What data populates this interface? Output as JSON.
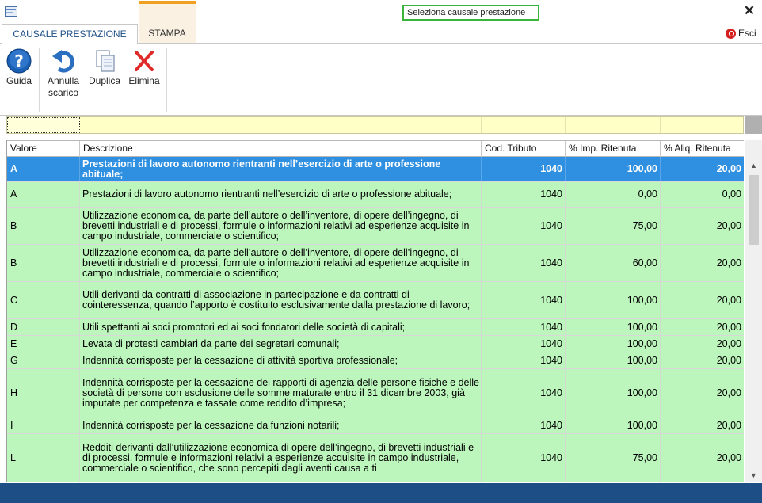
{
  "window": {
    "title": "Seleziona causale prestazione",
    "close_glyph": "✕"
  },
  "tabs": [
    {
      "label": "CAUSALE PRESTAZIONE",
      "active": true
    },
    {
      "label": "STAMPA",
      "active": false
    }
  ],
  "esci_label": "Esci",
  "ribbon": {
    "guida": {
      "label": "Guida",
      "icon": "help-icon"
    },
    "annulla": {
      "label_line1": "Annulla",
      "label_line2": "scarico",
      "icon": "undo-icon"
    },
    "duplica": {
      "label": "Duplica",
      "icon": "duplicate-icon"
    },
    "elimina": {
      "label": "Elimina",
      "icon": "delete-icon"
    }
  },
  "grid": {
    "columns": {
      "valore": "Valore",
      "descrizione": "Descrizione",
      "cod_tributo": "Cod. Tributo",
      "imp_ritenuta": "% Imp. Ritenuta",
      "aliq_ritenuta": "% Aliq. Ritenuta"
    },
    "rows": [
      {
        "valore": "A",
        "descrizione": "Prestazioni di lavoro autonomo rientranti nell’esercizio di arte o professione abituale;",
        "cod": "1040",
        "imp": "100,00",
        "aliq": "20,00",
        "selected": true
      },
      {
        "valore": "A",
        "descrizione": "Prestazioni di lavoro autonomo rientranti nell’esercizio di arte o professione abituale;",
        "cod": "1040",
        "imp": "0,00",
        "aliq": "0,00"
      },
      {
        "valore": "B",
        "descrizione": "Utilizzazione economica, da parte dell’autore o dell’inventore, di opere dell’ingegno, di brevetti industriali e di processi, formule o informazioni relativi ad esperienze acquisite in campo industriale, commerciale o scientifico;",
        "cod": "1040",
        "imp": "75,00",
        "aliq": "20,00"
      },
      {
        "valore": "B",
        "descrizione": "Utilizzazione economica, da parte dell’autore o dell’inventore, di opere dell’ingegno, di brevetti industriali e di processi, formule o informazioni relativi ad esperienze acquisite in campo industriale, commerciale o scientifico;",
        "cod": "1040",
        "imp": "60,00",
        "aliq": "20,00"
      },
      {
        "valore": "C",
        "descrizione": "Utili derivanti da contratti di associazione in partecipazione e da contratti di cointeressenza, quando l’apporto è costituito esclusivamente dalla prestazione di lavoro;",
        "cod": "1040",
        "imp": "100,00",
        "aliq": "20,00"
      },
      {
        "valore": "D",
        "descrizione": "Utili spettanti ai soci promotori ed ai soci fondatori delle società di capitali;",
        "cod": "1040",
        "imp": "100,00",
        "aliq": "20,00"
      },
      {
        "valore": "E",
        "descrizione": "Levata di protesti cambiari da parte dei segretari comunali;",
        "cod": "1040",
        "imp": "100,00",
        "aliq": "20,00"
      },
      {
        "valore": "G",
        "descrizione": "Indennità corrisposte per la cessazione di attività sportiva professionale;",
        "cod": "1040",
        "imp": "100,00",
        "aliq": "20,00"
      },
      {
        "valore": "H",
        "descrizione": "Indennità corrisposte per la cessazione dei rapporti di agenzia delle persone fisiche e delle società di persone con esclusione delle somme maturate entro il 31 dicembre 2003, già imputate per competenza e tassate come reddito d’impresa;",
        "cod": "1040",
        "imp": "100,00",
        "aliq": "20,00"
      },
      {
        "valore": "I",
        "descrizione": "Indennità corrisposte per la cessazione da funzioni notarili;",
        "cod": "1040",
        "imp": "100,00",
        "aliq": "20,00"
      },
      {
        "valore": "L",
        "descrizione": "Redditi derivanti dall’utilizzazione economica di opere dell’ingegno, di brevetti industriali e di processi, formule e informazioni relativi a esperienze acquisite in campo industriale, commerciale o scientifico, che sono percepiti dagli aventi causa a ti",
        "cod": "1040",
        "imp": "75,00",
        "aliq": "20,00"
      }
    ]
  },
  "colors": {
    "row_green": "#bdf6bd",
    "row_selected": "#2f8fe0",
    "filter_yellow": "#ffffc6",
    "status_blue": "#1d4f86",
    "title_border": "#3cb43c",
    "stampa_accent": "#f0a020"
  }
}
